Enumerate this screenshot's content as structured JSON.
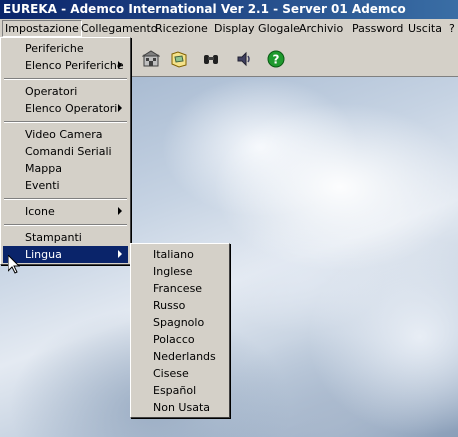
{
  "window": {
    "title": "EUREKA - Ademco International Ver 2.1 - Server 01 Ademco"
  },
  "menubar": [
    {
      "label": "Impostazione"
    },
    {
      "label": "Collegamento"
    },
    {
      "label": "Ricezione"
    },
    {
      "label": "Display Glogale"
    },
    {
      "label": "Archivio"
    },
    {
      "label": "Password"
    },
    {
      "label": "Uscita"
    },
    {
      "label": "?"
    }
  ],
  "toolbar": {
    "icons": [
      "building-icon",
      "map-folder-icon",
      "binoculars-icon",
      "speaker-icon",
      "help-icon"
    ]
  },
  "impostazione_menu": {
    "items": [
      {
        "label": "Periferiche"
      },
      {
        "label": "Elenco Periferiche"
      },
      {
        "label": "Operatori"
      },
      {
        "label": "Elenco Operatori"
      },
      {
        "label": "Video Camera"
      },
      {
        "label": "Comandi Seriali"
      },
      {
        "label": "Mappa"
      },
      {
        "label": "Eventi"
      },
      {
        "label": "Icone"
      },
      {
        "label": "Stampanti"
      },
      {
        "label": "Lingua"
      }
    ]
  },
  "lingua_menu": {
    "items": [
      {
        "label": "Italiano"
      },
      {
        "label": "Inglese"
      },
      {
        "label": "Francese"
      },
      {
        "label": "Russo"
      },
      {
        "label": "Spagnolo"
      },
      {
        "label": "Polacco"
      },
      {
        "label": "Nederlands"
      },
      {
        "label": "Cisese"
      },
      {
        "label": "Español"
      },
      {
        "label": "Non Usata"
      }
    ]
  },
  "colors": {
    "title_start": "#0a246a",
    "title_end": "#3a6ea5",
    "menu_bg": "#d4d0c8",
    "highlight": "#0a246a"
  }
}
